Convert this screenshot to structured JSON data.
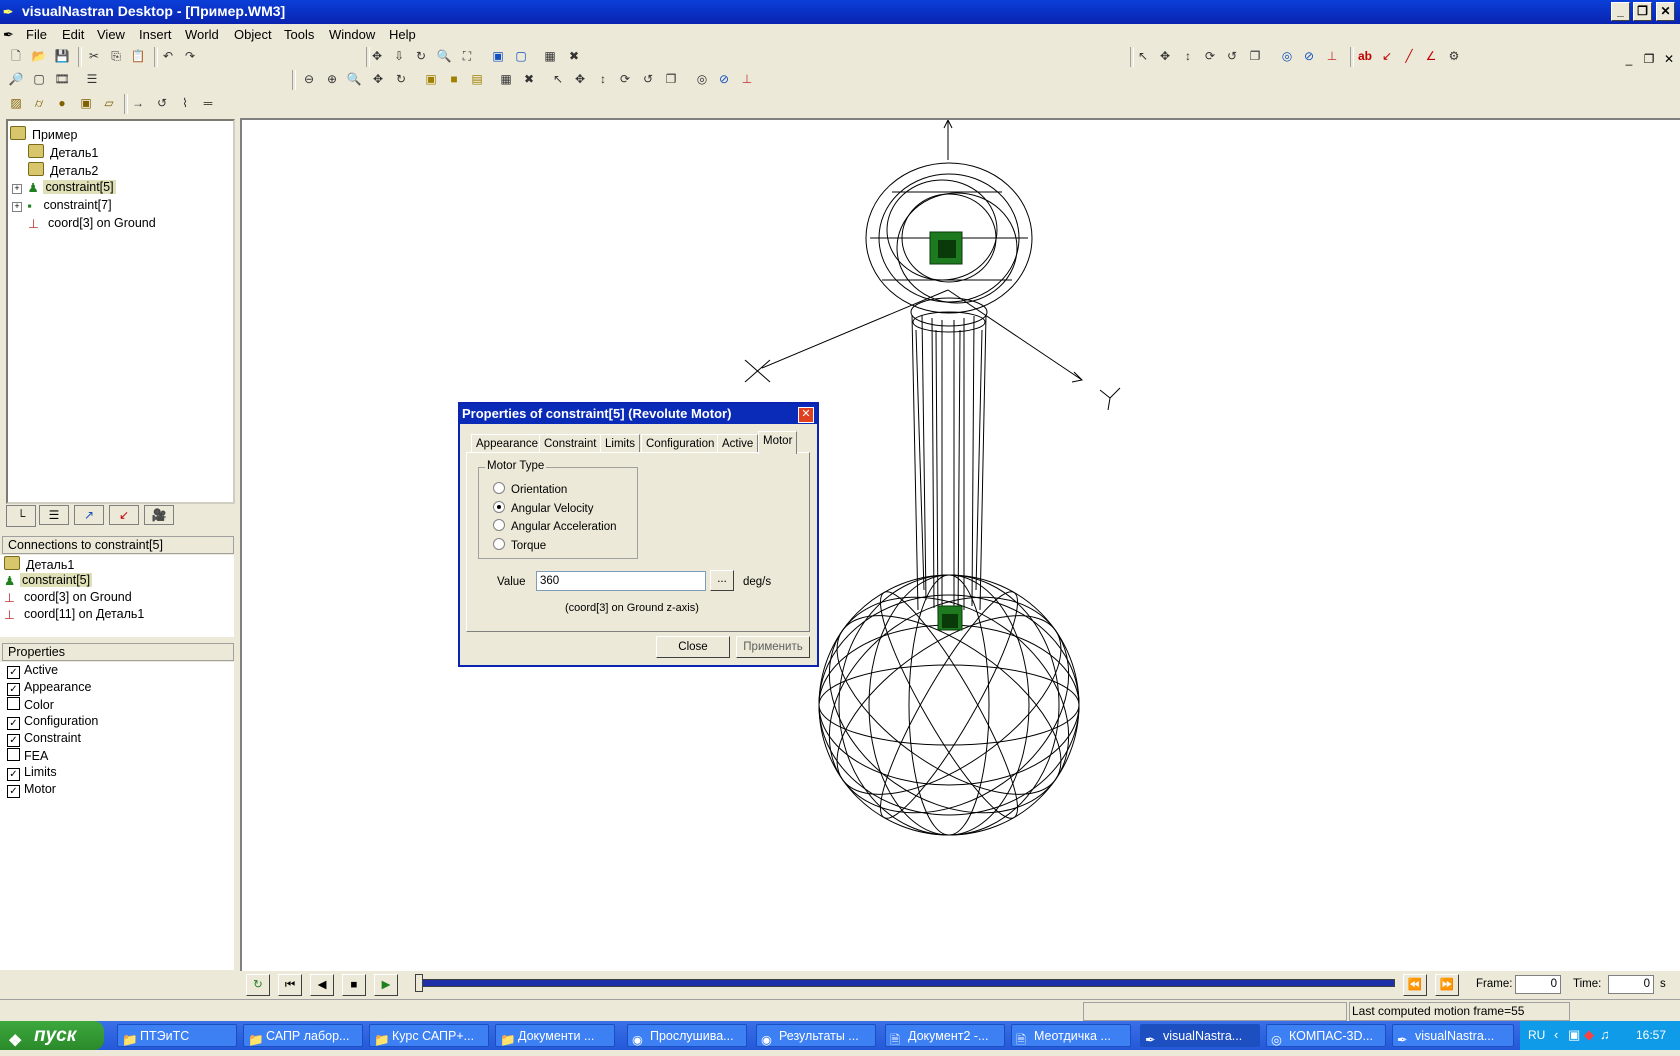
{
  "window": {
    "title": "visualNastran Desktop - [Пример.WM3]",
    "buttons": [
      "minimize",
      "maximize",
      "close"
    ]
  },
  "menu": {
    "items": [
      "File",
      "Edit",
      "View",
      "Insert",
      "World",
      "Object",
      "Tools",
      "Window",
      "Help"
    ]
  },
  "tree": {
    "items": [
      {
        "label": "Пример",
        "icon": "assembly-icon"
      },
      {
        "label": "Деталь1",
        "icon": "part-icon"
      },
      {
        "label": "Деталь2",
        "icon": "part-icon"
      },
      {
        "label": "constraint[5]",
        "icon": "motor-constraint-icon",
        "selected": true
      },
      {
        "label": "constraint[7]",
        "icon": "constraint-icon"
      },
      {
        "label": "coord[3] on Ground",
        "icon": "coord-icon"
      }
    ]
  },
  "connections": {
    "header": "Connections to constraint[5]",
    "items": [
      "Деталь1",
      "constraint[5]",
      "coord[3] on Ground",
      "coord[11] on Деталь1"
    ]
  },
  "properties": {
    "header": "Properties",
    "items": [
      {
        "label": "Active",
        "checked": true
      },
      {
        "label": "Appearance",
        "checked": true
      },
      {
        "label": "Color",
        "checked": false
      },
      {
        "label": "Configuration",
        "checked": true
      },
      {
        "label": "Constraint",
        "checked": true
      },
      {
        "label": "FEA",
        "checked": false
      },
      {
        "label": "Limits",
        "checked": true
      },
      {
        "label": "Motor",
        "checked": true
      }
    ]
  },
  "viewport": {
    "axis_labels": {
      "x": "X",
      "y": "Y"
    }
  },
  "dialog": {
    "title": "Properties of constraint[5] (Revolute Motor)",
    "tabs": [
      "Appearance",
      "Constraint",
      "Limits",
      "Configuration",
      "Active",
      "Motor"
    ],
    "active_tab": "Motor",
    "motor_type_label": "Motor Type",
    "motor_types": [
      {
        "label": "Orientation",
        "selected": false
      },
      {
        "label": "Angular Velocity",
        "selected": true
      },
      {
        "label": "Angular Acceleration",
        "selected": false
      },
      {
        "label": "Torque",
        "selected": false
      }
    ],
    "value_label": "Value",
    "value": "360",
    "browse_label": "...",
    "unit": "deg/s",
    "note": "(coord[3] on Ground z-axis)",
    "close_label": "Close",
    "apply_label": "Применить"
  },
  "animation": {
    "frame_label": "Frame:",
    "frame_value": "0",
    "time_label": "Time:",
    "time_value": "0",
    "time_unit": "s"
  },
  "status": {
    "message": "Last computed motion frame=55"
  },
  "taskbar": {
    "start_label": "пуск",
    "tasks": [
      {
        "label": "ПТЭиТС",
        "icon": "folder-icon"
      },
      {
        "label": "САПР лабор...",
        "icon": "folder-icon"
      },
      {
        "label": "Курс САПР+...",
        "icon": "folder-icon"
      },
      {
        "label": "Документи ...",
        "icon": "folder-icon"
      },
      {
        "label": "Прослушива...",
        "icon": "browser-icon"
      },
      {
        "label": "Результаты ...",
        "icon": "browser-icon"
      },
      {
        "label": "Документ2 -...",
        "icon": "word-icon"
      },
      {
        "label": "Меотдичка ...",
        "icon": "word-icon"
      },
      {
        "label": "visualNastra...",
        "icon": "visualnastran-icon",
        "active": true
      },
      {
        "label": "КОМПАС-3D...",
        "icon": "kompas-icon"
      },
      {
        "label": "visualNastra...",
        "icon": "visualnastran-icon"
      }
    ],
    "language": "RU",
    "clock": "16:57"
  }
}
